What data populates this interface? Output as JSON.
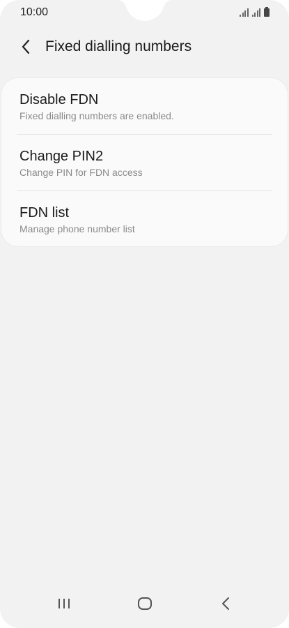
{
  "status_bar": {
    "time": "10:00",
    "icons": [
      "signal-icon",
      "signal-icon",
      "battery-icon"
    ]
  },
  "header": {
    "back_icon": "chevron-left-icon",
    "title": "Fixed dialling numbers"
  },
  "settings": {
    "items": [
      {
        "title": "Disable FDN",
        "subtitle": "Fixed dialling numbers are enabled."
      },
      {
        "title": "Change PIN2",
        "subtitle": "Change PIN for FDN access"
      },
      {
        "title": "FDN list",
        "subtitle": "Manage phone number list"
      }
    ]
  },
  "nav_bar": {
    "icons": [
      "recents-icon",
      "home-icon",
      "back-icon"
    ]
  },
  "colors": {
    "background": "#f2f2f2",
    "card": "#fafafa",
    "text_primary": "#1a1a1a",
    "text_secondary": "#8a8a8a"
  }
}
